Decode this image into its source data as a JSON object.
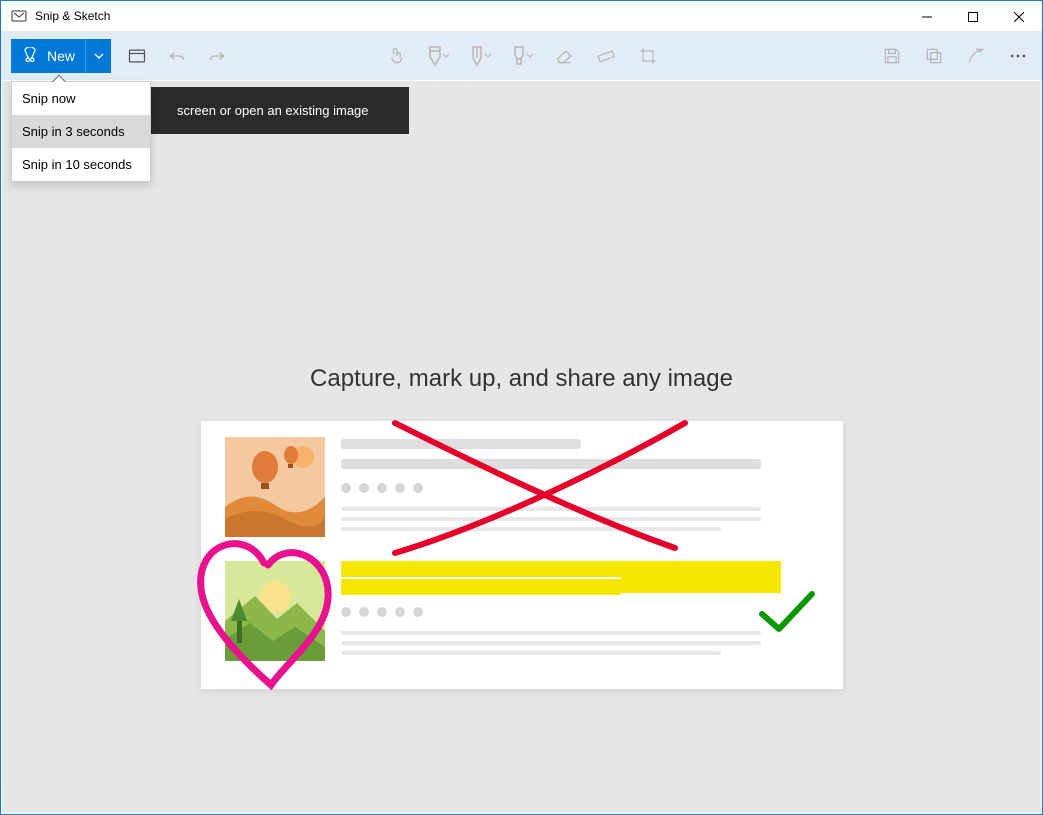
{
  "window": {
    "title": "Snip & Sketch"
  },
  "toolbar": {
    "new_label": "New"
  },
  "dropdown": {
    "items": [
      {
        "label": "Snip now"
      },
      {
        "label": "Snip in 3 seconds"
      },
      {
        "label": "Snip in 10 seconds"
      }
    ],
    "hover_index": 1
  },
  "tooltip": {
    "text": "screen or open an existing image"
  },
  "main": {
    "heading": "Capture, mark up, and share any image"
  },
  "colors": {
    "accent": "#0078d7",
    "toolbar_bg": "#e1ecf7",
    "canvas_bg": "#e6e6e6",
    "highlight": "#f7e600",
    "red": "#e4002b",
    "pink": "#e8118e",
    "green": "#0a9a00"
  }
}
